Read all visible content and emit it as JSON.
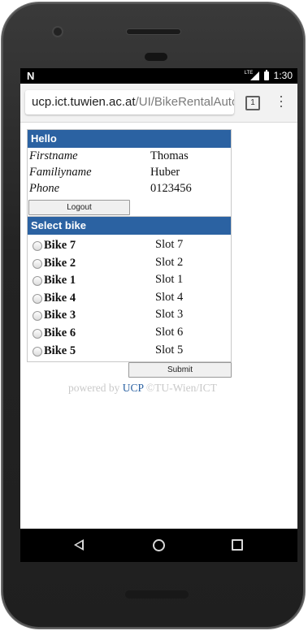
{
  "status_bar": {
    "carrier_icon": "N",
    "network": "LTE",
    "time": "1:30"
  },
  "browser": {
    "url_host": "ucp.ict.tuwien.ac.at",
    "url_path": "/UI/BikeRentalAuto",
    "tab_count": "1",
    "menu_icon": "⋮"
  },
  "hello": {
    "title": "Hello",
    "firstname_label": "Firstname",
    "firstname_value": "Thomas",
    "familyname_label": "Familiyname",
    "familyname_value": "Huber",
    "phone_label": "Phone",
    "phone_value": "0123456",
    "logout_label": "Logout"
  },
  "select": {
    "title": "Select bike",
    "bikes": [
      {
        "name": "Bike 7",
        "slot": "Slot 7"
      },
      {
        "name": "Bike 2",
        "slot": "Slot 2"
      },
      {
        "name": "Bike 1",
        "slot": "Slot 1"
      },
      {
        "name": "Bike 4",
        "slot": "Slot 4"
      },
      {
        "name": "Bike 3",
        "slot": "Slot 3"
      },
      {
        "name": "Bike 6",
        "slot": "Slot 6"
      },
      {
        "name": "Bike 5",
        "slot": "Slot 5"
      }
    ],
    "submit_label": "Submit"
  },
  "footer": {
    "powered_prefix": "powered by ",
    "brand": "UCP",
    "suffix": " ©TU-Wien/ICT"
  },
  "colors": {
    "accent": "#2b62a2"
  }
}
